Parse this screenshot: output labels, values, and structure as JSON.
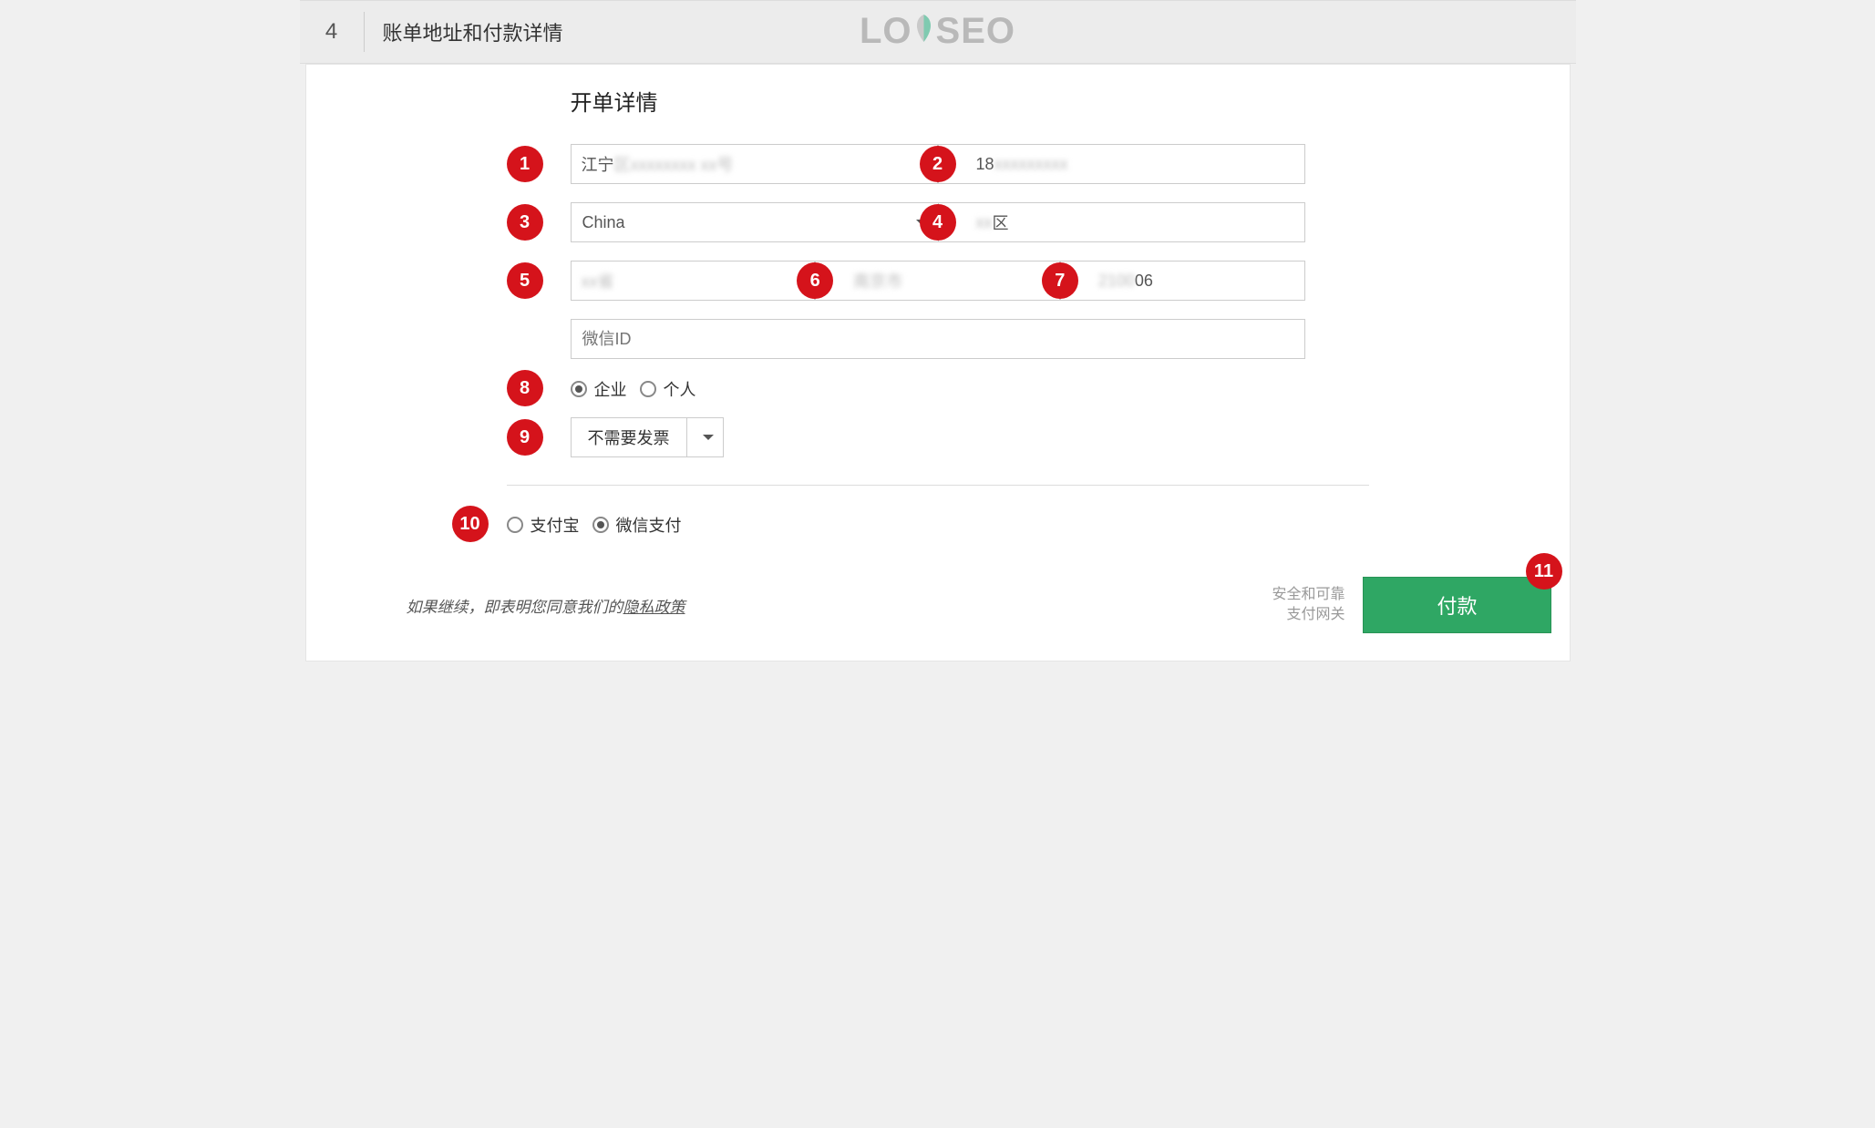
{
  "header": {
    "step_number": "4",
    "step_title": "账单地址和付款详情",
    "logo_text_1": "LO",
    "logo_text_2": "SEO"
  },
  "section_title": "开单详情",
  "fields": {
    "address_prefix": "江宁",
    "address_blur": "区xxxxxxxx xx号",
    "phone_prefix": "18",
    "phone_blur": "xxxxxxxxx",
    "country": "China",
    "district_blur": "xx",
    "district_suffix": "区",
    "field5_blur": "xx省",
    "field6_blur": "南京市",
    "field7_blur": "2100",
    "field7_suffix": "06",
    "wechat_placeholder": "微信ID"
  },
  "entity_type": {
    "company": "企业",
    "personal": "个人",
    "selected": "company"
  },
  "invoice": {
    "label": "不需要发票"
  },
  "payment": {
    "alipay": "支付宝",
    "wechat": "微信支付",
    "selected": "wechat"
  },
  "footer": {
    "disclaimer_prefix": "如果继续，即表明您同意我们的",
    "privacy_link": "隐私政策",
    "secure_line1": "安全和可靠",
    "secure_line2": "支付网关",
    "pay_button": "付款"
  },
  "badges": {
    "b1": "1",
    "b2": "2",
    "b3": "3",
    "b4": "4",
    "b5": "5",
    "b6": "6",
    "b7": "7",
    "b8": "8",
    "b9": "9",
    "b10": "10",
    "b11": "11"
  }
}
